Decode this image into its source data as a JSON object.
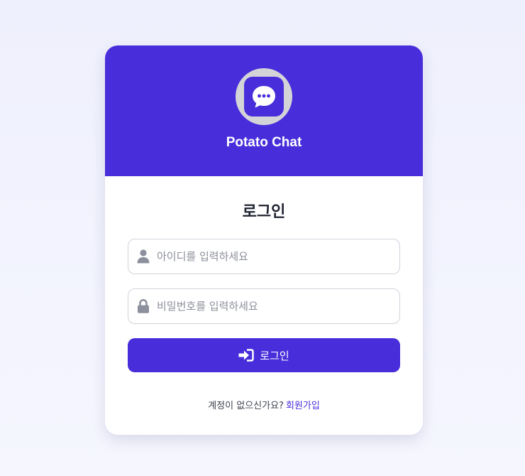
{
  "header": {
    "app_name": "Potato Chat",
    "logo_icon": "chat-bubble-icon"
  },
  "form": {
    "title": "로그인",
    "username": {
      "placeholder": "아이디를 입력하세요",
      "value": "",
      "icon": "user-icon"
    },
    "password": {
      "placeholder": "비밀번호를 입력하세요",
      "value": "",
      "icon": "lock-icon"
    },
    "submit": {
      "label": "로그인",
      "icon": "sign-in-icon"
    }
  },
  "footer": {
    "prompt": "계정이 없으신가요?",
    "signup_label": "회원가입"
  },
  "colors": {
    "brand": "#482edb",
    "background": "#eff0fd",
    "logo_ring": "#d4d4d8"
  }
}
